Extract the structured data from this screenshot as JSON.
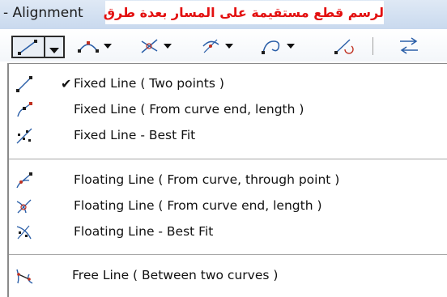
{
  "window": {
    "title": "- Alignment"
  },
  "annotation": {
    "text": "لرسم قطع مستقيمة على المسار بعدة طرق",
    "color": "#e31010"
  },
  "toolbar": {
    "buttons": [
      {
        "icon": "line-tool-icon",
        "has_dropdown": true,
        "active": true
      },
      {
        "icon": "arc-tool-icon",
        "has_dropdown": true
      },
      {
        "icon": "intersection-tool-icon",
        "has_dropdown": true
      },
      {
        "icon": "curve-tool-icon",
        "has_dropdown": true
      },
      {
        "icon": "spiral-tool-icon",
        "has_dropdown": true
      },
      {
        "icon": "line-edit-icon",
        "has_dropdown": false
      },
      {
        "icon": "reverse-direction-icon",
        "has_dropdown": false
      }
    ]
  },
  "menu": {
    "groups": [
      {
        "items": [
          {
            "label": "Fixed Line ( Two points )",
            "checked": true,
            "icon": "fixed-line-two-points-icon"
          },
          {
            "label": "Fixed Line ( From curve end, length )",
            "checked": false,
            "icon": "fixed-line-curve-end-icon"
          },
          {
            "label": "Fixed Line - Best Fit",
            "checked": false,
            "icon": "fixed-line-best-fit-icon"
          }
        ]
      },
      {
        "items": [
          {
            "label": "Floating Line  ( From curve, through point )",
            "checked": false,
            "icon": "floating-line-through-point-icon"
          },
          {
            "label": "Floating Line  ( From curve end, length )",
            "checked": false,
            "icon": "floating-line-curve-end-icon"
          },
          {
            "label": "Floating Line - Best Fit",
            "checked": false,
            "icon": "floating-line-best-fit-icon"
          }
        ]
      },
      {
        "items": [
          {
            "label": "Free Line   ( Between two curves )",
            "checked": false,
            "icon": "free-line-between-curves-icon"
          }
        ]
      }
    ],
    "check_glyph": "✔"
  }
}
